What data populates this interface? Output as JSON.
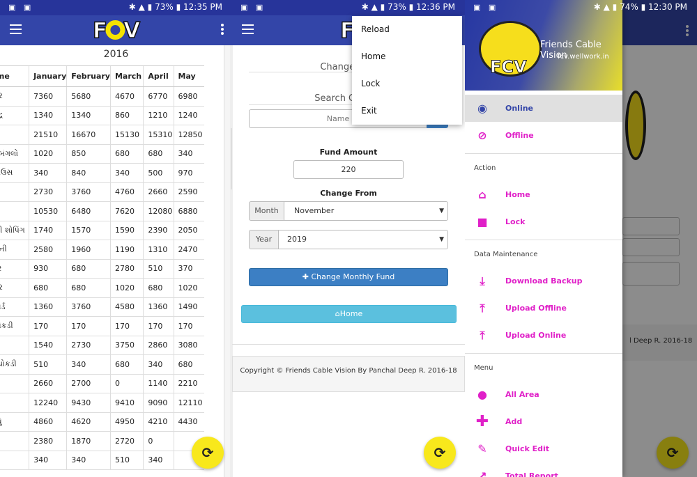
{
  "screen1": {
    "status": {
      "battery": "73%",
      "time": "12:35 PM"
    },
    "year": "2016",
    "columns": [
      "a Name",
      "January",
      "February",
      "March",
      "April",
      "May"
    ],
    "rows": [
      [
        "ા નગર",
        "7360",
        "5680",
        "4670",
        "6770",
        "6980"
      ],
      [
        "ગ્ય કેન્દ્ર",
        "1340",
        "1340",
        "860",
        "1210",
        "1240"
      ],
      [
        "મા પાર્ક",
        "21510",
        "16670",
        "15130",
        "15310",
        "12850"
      ],
      [
        "ીર્વાદ બંગલો",
        "1020",
        "850",
        "680",
        "680",
        "340"
      ],
      [
        "ીન હાઉસ",
        "340",
        "840",
        "340",
        "500",
        "970"
      ],
      [
        "ારમાં",
        "2730",
        "3760",
        "4760",
        "2660",
        "2590"
      ],
      [
        "ટેન્ડ",
        "10530",
        "6480",
        "7620",
        "12080",
        "6880"
      ],
      [
        "ાલક્ષ્મી શોપિંગ",
        "1740",
        "1570",
        "1590",
        "2390",
        "2050"
      ],
      [
        "F કોલોની",
        "2580",
        "1960",
        "1190",
        "1310",
        "2470"
      ],
      [
        "ત્રી નગર",
        "930",
        "680",
        "2780",
        "510",
        "370"
      ],
      [
        "ા નગર",
        "680",
        "680",
        "1020",
        "680",
        "1020"
      ],
      [
        "સિંગ બોર્ડ",
        "1360",
        "3760",
        "4580",
        "1360",
        "1490"
      ],
      [
        "ાન ચોકડી",
        "170",
        "170",
        "170",
        "170",
        "170"
      ],
      [
        "પાર્ક",
        "1540",
        "2730",
        "3750",
        "2860",
        "3080"
      ],
      [
        "ડી.બી.ચોકડી",
        "510",
        "340",
        "680",
        "340",
        "680"
      ],
      [
        "ીલ",
        "2660",
        "2700",
        "0",
        "1140",
        "2210"
      ],
      [
        "પાછળ",
        "12240",
        "9430",
        "9410",
        "9090",
        "12110"
      ],
      [
        ". ફળીયું",
        "4860",
        "4620",
        "4950",
        "4210",
        "4430"
      ],
      [
        "ર શાળા",
        "2380",
        "1870",
        "2720",
        "0",
        ""
      ],
      [
        "",
        "340",
        "340",
        "510",
        "340",
        ""
      ]
    ]
  },
  "screen2": {
    "status": {
      "battery": "73%",
      "time": "12:36 PM"
    },
    "change_title": "Change Mon",
    "search_title": "Search Connec",
    "name_label": "Name",
    "fund_amount_label": "Fund Amount",
    "fund_amount_value": "220",
    "change_from_label": "Change From",
    "month_label": "Month",
    "month_value": "November",
    "year_label": "Year",
    "year_value": "2019",
    "change_button": "Change Monthly Fund",
    "home_button": "Home",
    "footer": "Copyright © Friends Cable Vision By Panchal Deep R. 2016-18",
    "menu": [
      "Reload",
      "Home",
      "Lock",
      "Exit"
    ]
  },
  "screen3": {
    "status": {
      "battery": "74%",
      "time": "12:30 PM"
    },
    "drawer_title": "Friends Cable Vision",
    "drawer_subtitle": "fcv.wellwork.in",
    "items_top": [
      "Online",
      "Offline"
    ],
    "section_action": "Action",
    "items_action": [
      "Home",
      "Lock"
    ],
    "section_data": "Data Maintenance",
    "items_data": [
      "Download Backup",
      "Upload Offline",
      "Upload Online"
    ],
    "section_menu": "Menu",
    "items_menu": [
      "All Area",
      "Add",
      "Quick Edit",
      "Total Report"
    ],
    "behind_footer": "l Deep R. 2016-18"
  },
  "app_logo_text": "FCV",
  "colors": {
    "appbar": "#3345a8",
    "fab": "#f8e81c",
    "accent": "#e020c8",
    "primary_btn": "#3c7fc4",
    "info_btn": "#5bc0de"
  }
}
